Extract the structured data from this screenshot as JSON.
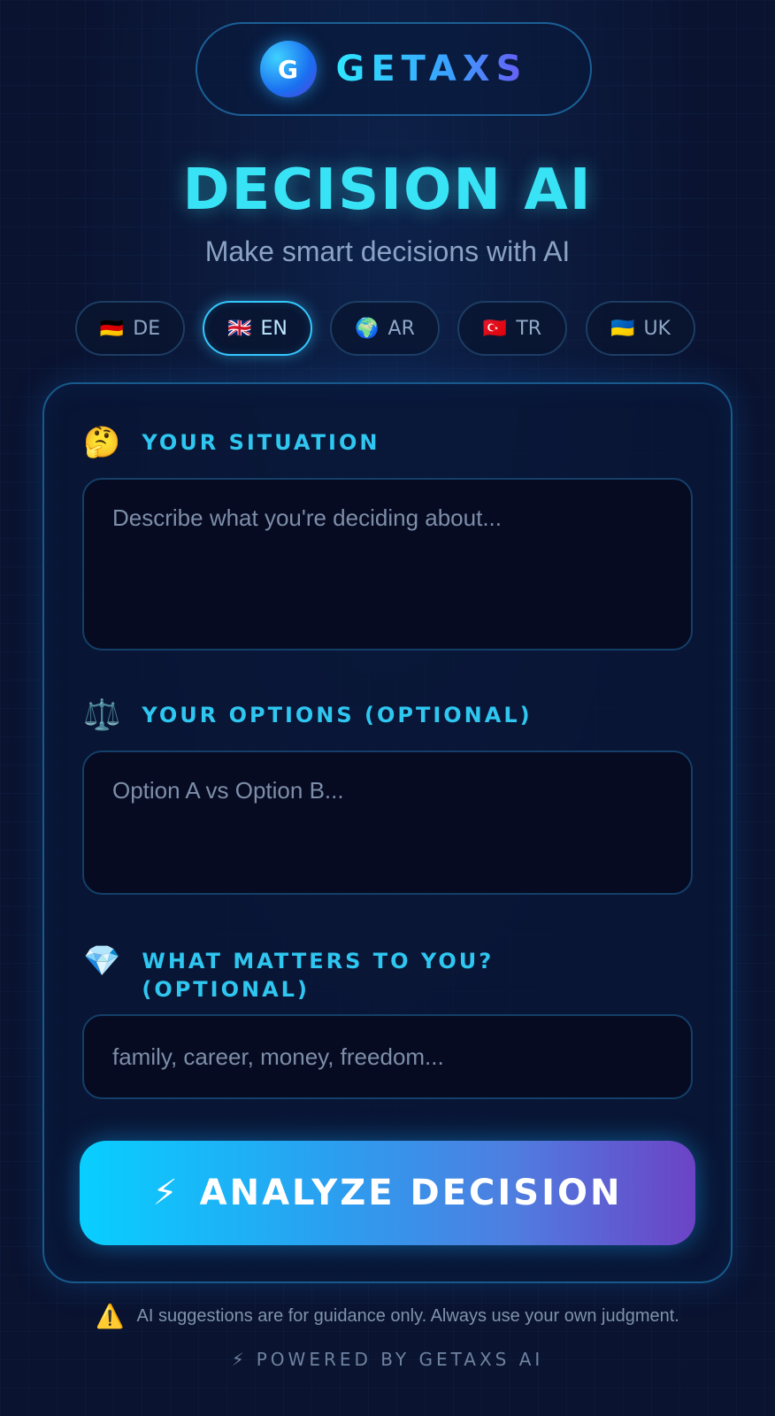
{
  "brand": {
    "logo_letter": "G",
    "name": "GETAXS"
  },
  "header": {
    "title": "DECISION AI",
    "subtitle": "Make smart decisions with AI"
  },
  "languages": [
    {
      "flag": "🇩🇪",
      "code": "DE",
      "active": false
    },
    {
      "flag": "🇬🇧",
      "code": "EN",
      "active": true
    },
    {
      "flag": "🌍",
      "code": "AR",
      "active": false
    },
    {
      "flag": "🇹🇷",
      "code": "TR",
      "active": false
    },
    {
      "flag": "🇺🇦",
      "code": "UK",
      "active": false
    }
  ],
  "form": {
    "situation": {
      "emoji": "🤔",
      "label": "YOUR SITUATION",
      "placeholder": "Describe what you're deciding about...",
      "value": ""
    },
    "options": {
      "emoji": "⚖️",
      "label": "YOUR OPTIONS (OPTIONAL)",
      "placeholder": "Option A vs Option B...",
      "value": ""
    },
    "values": {
      "emoji": "💎",
      "label": "WHAT MATTERS TO YOU? (OPTIONAL)",
      "placeholder": "family, career, money, freedom...",
      "value": ""
    },
    "submit": {
      "icon": "⚡",
      "label": "ANALYZE DECISION"
    }
  },
  "footer": {
    "disclaimer_icon": "⚠️",
    "disclaimer": "AI suggestions are for guidance only. Always use your own judgment.",
    "powered_icon": "⚡",
    "powered_by": "POWERED BY GETAXS AI"
  },
  "colors": {
    "background": "#0a1330",
    "accent": "#38e3f5",
    "button_start": "#08cfff",
    "button_end": "#6c43c6"
  }
}
